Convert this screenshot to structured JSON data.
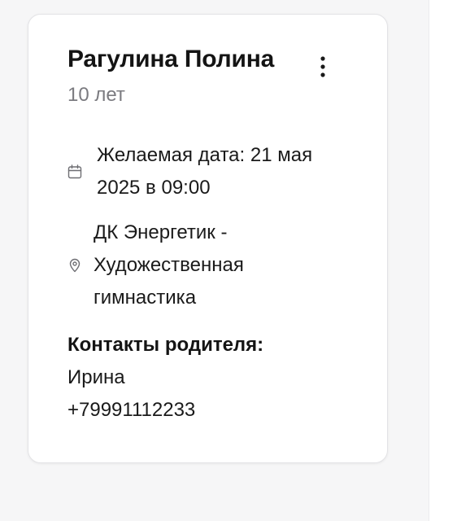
{
  "card": {
    "name": "Рагулина Полина",
    "age": "10 лет",
    "menu_icon": "more-vertical-icon",
    "desired_date": {
      "icon": "calendar-icon",
      "text": "Желаемая дата: 21 мая 2025 в 09:00"
    },
    "location": {
      "icon": "location-pin-icon",
      "text": "ДК Энергетик - Художественная гимнастика"
    },
    "contacts": {
      "label": "Контакты родителя:",
      "parent_name": "Ирина",
      "phone": "+79991112233"
    }
  },
  "colors": {
    "background": "#f6f6f7",
    "card": "#ffffff",
    "card_border": "#e3e3e6",
    "muted_text": "#7b7b80",
    "icon": "#6e6e73"
  }
}
